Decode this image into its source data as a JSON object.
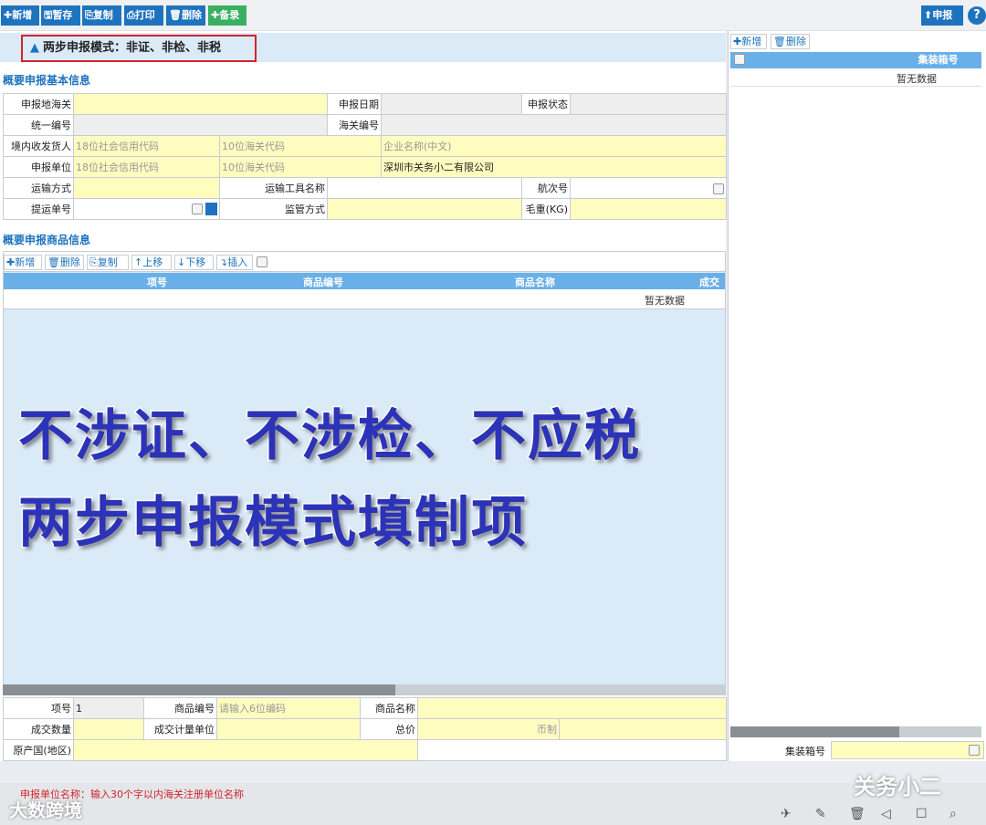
{
  "toolbar": {
    "add": "新增",
    "save": "暂存",
    "copy": "复制",
    "print": "打印",
    "delete": "删除",
    "record": "备录",
    "declare": "申报",
    "help": "?"
  },
  "notice": {
    "icon": "warning-icon",
    "text": "两步申报模式：非证、非检、非税"
  },
  "basic": {
    "title": "概要申报基本信息",
    "declare_customs": "申报地海关",
    "declare_date": "申报日期",
    "declare_status": "申报状态",
    "unified_no": "统一编号",
    "customs_no": "海关编号",
    "consignee": "境内收发货人",
    "credit_code_ph": "18位社会信用代码",
    "customs_code_ph": "10位海关代码",
    "company_name_ph": "企业名称(中文)",
    "declarant": "申报单位",
    "declarant_name": "深圳市关务小二有限公司",
    "transport_mode": "运输方式",
    "transport_name": "运输工具名称",
    "voyage_no": "航次号",
    "bill_no": "提运单号",
    "supervision": "监管方式",
    "gross_weight": "毛重(KG)"
  },
  "goods": {
    "title": "概要申报商品信息",
    "add": "新增",
    "delete": "删除",
    "copy": "复制",
    "up": "上移",
    "down": "下移",
    "insert": "插入",
    "columns": [
      "项号",
      "商品编号",
      "商品名称",
      "成交"
    ],
    "empty": "暂无数据"
  },
  "overlay": {
    "line1": "不涉证、不涉检、不应税",
    "line2": "两步申报模式填制项"
  },
  "detail": {
    "item_no": "项号",
    "item_no_val": "1",
    "goods_code": "商品编号",
    "goods_code_ph": "请输入6位编码",
    "goods_name": "商品名称",
    "qty": "成交数量",
    "unit": "成交计量单位",
    "total": "总价",
    "currency": "币制",
    "origin": "原产国(地区)"
  },
  "container": {
    "add": "新增",
    "delete": "删除",
    "column": "集装箱号",
    "empty": "暂无数据",
    "footer_label": "集装箱号"
  },
  "status": {
    "error": "申报单位名称：输入30个字以内海关注册单位名称"
  },
  "watermarks": {
    "left": "大数跨境",
    "right": "关务小二"
  }
}
